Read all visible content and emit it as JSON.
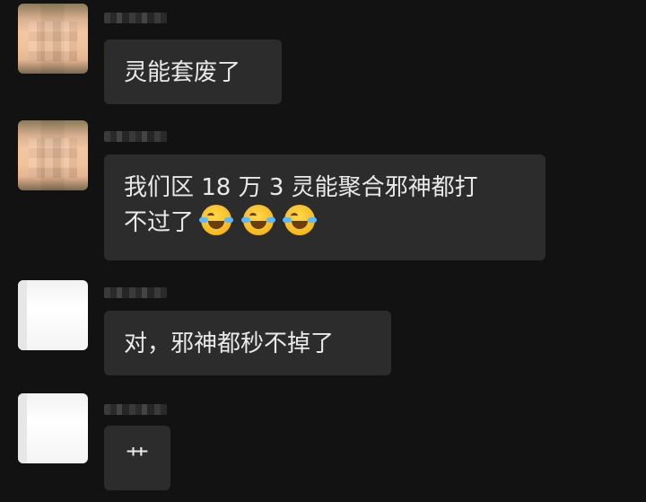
{
  "messages": [
    {
      "avatar": "peach-avatar",
      "text": "灵能套废了"
    },
    {
      "avatar": "peach-avatar",
      "text_line1": "我们区 18 万 3 灵能聚合邪神都打",
      "text_line2": "不过了",
      "emojis": [
        "crying-laughing-emoji",
        "crying-laughing-emoji",
        "crying-laughing-emoji"
      ]
    },
    {
      "avatar": "white-avatar",
      "text": "对，邪神都秒不掉了"
    },
    {
      "avatar": "white-avatar",
      "text": "艹"
    }
  ]
}
